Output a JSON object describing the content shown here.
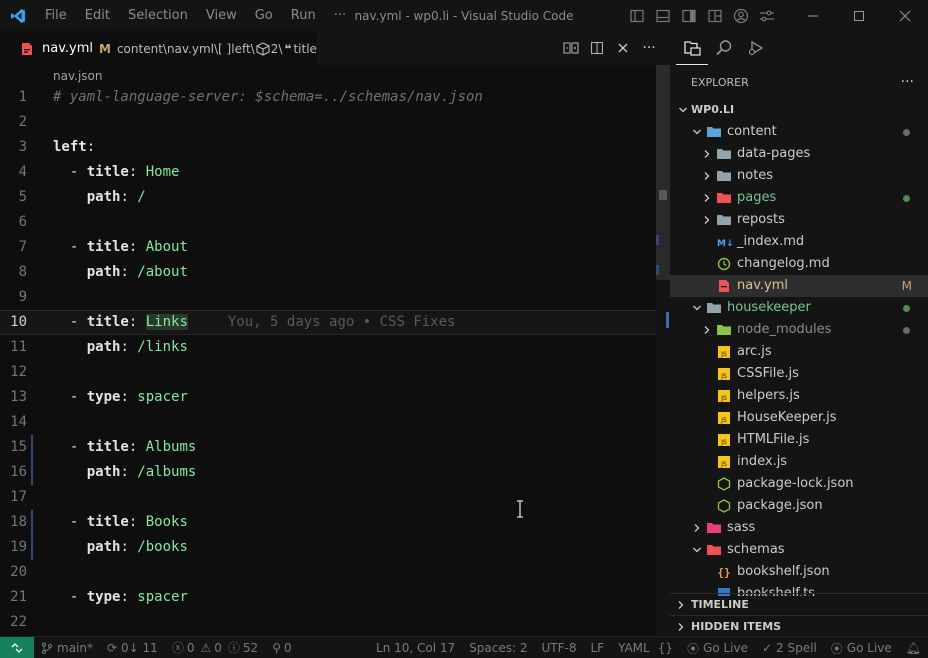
{
  "window": {
    "title": "nav.yml - wp0.li - Visual Studio Code",
    "menu": [
      "File",
      "Edit",
      "Selection",
      "View",
      "Go",
      "Run",
      "···"
    ]
  },
  "tab": {
    "name": "nav.yml",
    "modified": "M",
    "path_inline": "content\\nav.yml\\[ ]left\\",
    "crumb_index": "2\\",
    "crumb_key": "title"
  },
  "breadcrumb": "nav.json",
  "code": {
    "lines": [
      {
        "n": "1",
        "comment": "# yaml-language-server: $schema=../schemas/nav.json"
      },
      {
        "n": "2"
      },
      {
        "n": "3",
        "key": "left",
        "sep": ":"
      },
      {
        "n": "4",
        "dash": "- ",
        "key": "title",
        "sep": ": ",
        "value": "Home"
      },
      {
        "n": "5",
        "key": "path",
        "sep": ": ",
        "value": "/"
      },
      {
        "n": "6"
      },
      {
        "n": "7",
        "dash": "- ",
        "key": "title",
        "sep": ": ",
        "value": "About"
      },
      {
        "n": "8",
        "key": "path",
        "sep": ": ",
        "value": "/about"
      },
      {
        "n": "9"
      },
      {
        "n": "10",
        "dash": "- ",
        "key": "title",
        "sep": ": ",
        "value": "Links",
        "blame": "You, 5 days ago • CSS Fixes",
        "current": true
      },
      {
        "n": "11",
        "key": "path",
        "sep": ": ",
        "value": "/links"
      },
      {
        "n": "12"
      },
      {
        "n": "13",
        "dash": "- ",
        "key": "type",
        "sep": ": ",
        "value": "spacer"
      },
      {
        "n": "14"
      },
      {
        "n": "15",
        "dash": "- ",
        "key": "title",
        "sep": ": ",
        "value": "Albums"
      },
      {
        "n": "16",
        "key": "path",
        "sep": ": ",
        "value": "/albums"
      },
      {
        "n": "17"
      },
      {
        "n": "18",
        "dash": "- ",
        "key": "title",
        "sep": ": ",
        "value": "Books"
      },
      {
        "n": "19",
        "key": "path",
        "sep": ": ",
        "value": "/books"
      },
      {
        "n": "20"
      },
      {
        "n": "21",
        "dash": "- ",
        "key": "type",
        "sep": ": ",
        "value": "spacer"
      },
      {
        "n": "22"
      }
    ]
  },
  "explorer": {
    "heading": "EXPLORER",
    "more": "···",
    "root": "WP0.LI",
    "items": [
      {
        "label": "content",
        "kind": "folder-open",
        "depth": 1,
        "color": "#5aa5d6",
        "dot": "#6b6b6b",
        "label_color": "#cccccc"
      },
      {
        "label": "data-pages",
        "kind": "folder",
        "depth": 2,
        "color": "#90a4ae",
        "label_color": "#cccccc"
      },
      {
        "label": "notes",
        "kind": "folder",
        "depth": 2,
        "color": "#90a4ae",
        "label_color": "#cccccc"
      },
      {
        "label": "pages",
        "kind": "folder",
        "depth": 2,
        "color": "#ef5350",
        "dot": "#4e8a4e",
        "label_color": "#73c991"
      },
      {
        "label": "reposts",
        "kind": "folder",
        "depth": 2,
        "color": "#90a4ae",
        "label_color": "#cccccc"
      },
      {
        "label": "_index.md",
        "kind": "md",
        "depth": 2,
        "color": "#42a5f5",
        "label_color": "#cccccc"
      },
      {
        "label": "changelog.md",
        "kind": "log",
        "depth": 2,
        "color": "#8bc34a",
        "label_color": "#cccccc"
      },
      {
        "label": "nav.yml",
        "kind": "yml",
        "depth": 2,
        "color": "#ef5350",
        "label_color": "#e2c08d",
        "selected": true,
        "mark": "M"
      },
      {
        "label": "housekeeper",
        "kind": "folder-open",
        "depth": 1,
        "color": "#90a4ae",
        "dot": "#4e8a4e",
        "label_color": "#73c991"
      },
      {
        "label": "node_modules",
        "kind": "folder",
        "depth": 2,
        "color": "#8bc34a",
        "dot": "#6b6b6b",
        "label_color": "#8c8c8c"
      },
      {
        "label": "arc.js",
        "kind": "js",
        "depth": 2,
        "color": "#f5c518",
        "label_color": "#cccccc"
      },
      {
        "label": "CSSFile.js",
        "kind": "js",
        "depth": 2,
        "color": "#f5c518",
        "label_color": "#cccccc"
      },
      {
        "label": "helpers.js",
        "kind": "js",
        "depth": 2,
        "color": "#f5c518",
        "label_color": "#cccccc"
      },
      {
        "label": "HouseKeeper.js",
        "kind": "js",
        "depth": 2,
        "color": "#f5c518",
        "label_color": "#cccccc"
      },
      {
        "label": "HTMLFile.js",
        "kind": "js",
        "depth": 2,
        "color": "#f5c518",
        "label_color": "#cccccc"
      },
      {
        "label": "index.js",
        "kind": "js",
        "depth": 2,
        "color": "#f5c518",
        "label_color": "#cccccc"
      },
      {
        "label": "package-lock.json",
        "kind": "node",
        "depth": 2,
        "color": "#8bc34a",
        "label_color": "#cccccc"
      },
      {
        "label": "package.json",
        "kind": "node",
        "depth": 2,
        "color": "#8bc34a",
        "label_color": "#cccccc"
      },
      {
        "label": "sass",
        "kind": "folder",
        "depth": 1,
        "color": "#ec407a",
        "label_color": "#cccccc"
      },
      {
        "label": "schemas",
        "kind": "folder-open",
        "depth": 1,
        "color": "#ef5350",
        "label_color": "#cccccc"
      },
      {
        "label": "bookshelf.json",
        "kind": "json",
        "depth": 2,
        "color": "#f0a030",
        "label_color": "#cccccc"
      },
      {
        "label": "bookshelf.ts",
        "kind": "ts",
        "depth": 2,
        "color": "#3178c6",
        "label_color": "#cccccc"
      }
    ],
    "sections": [
      "TIMELINE",
      "HIDDEN ITEMS"
    ]
  },
  "status": {
    "branch": "main*",
    "sync": "0↓ 11",
    "errors": "0",
    "warnings": "0",
    "info": "52",
    "ports": "0",
    "position": "Ln 10, Col 17",
    "spaces": "Spaces: 2",
    "encoding": "UTF-8",
    "eol": "LF",
    "language": "YAML",
    "golive1": "Go Live",
    "spell": "2 Spell",
    "golive2": "Go Live"
  },
  "colors": {
    "accent": "#16825d",
    "comment": "#6a737d",
    "value": "#85e89d",
    "modified": "#c9a26d"
  }
}
